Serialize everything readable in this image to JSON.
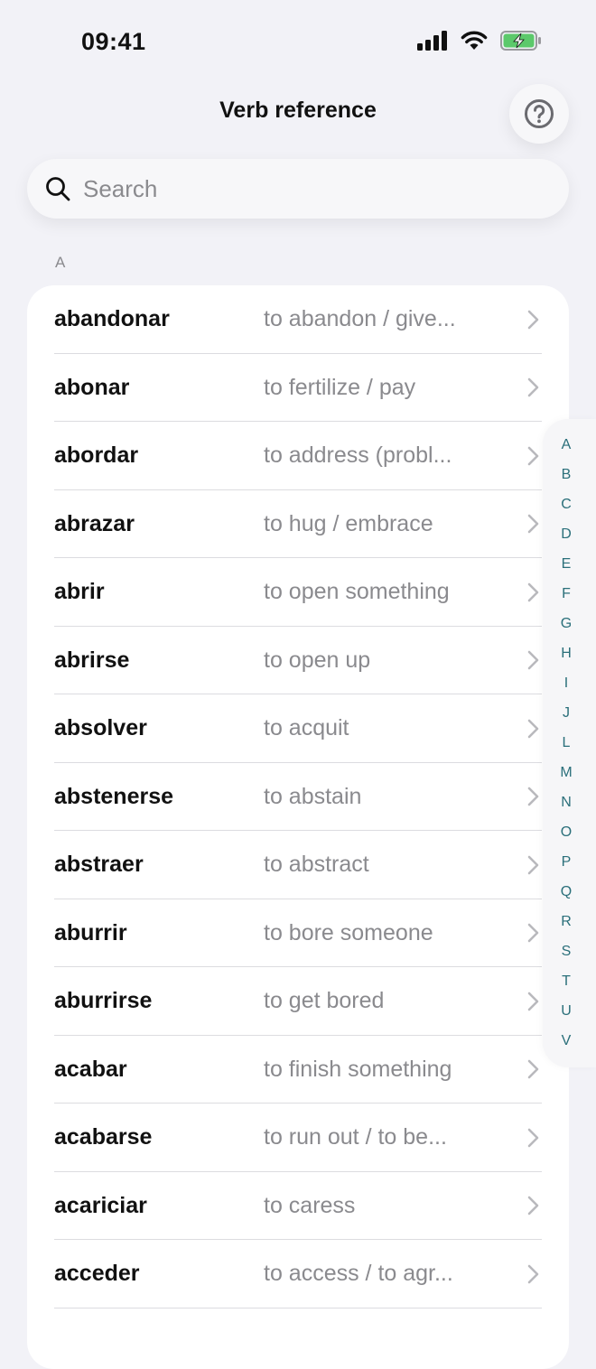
{
  "status_bar": {
    "time": "09:41"
  },
  "nav": {
    "title": "Verb reference",
    "help_icon": "question-circle-icon"
  },
  "search": {
    "placeholder": "Search",
    "value": ""
  },
  "section": {
    "letter": "A"
  },
  "verbs": [
    {
      "term": "abandonar",
      "definition": "to abandon / give..."
    },
    {
      "term": "abonar",
      "definition": "to fertilize / pay"
    },
    {
      "term": "abordar",
      "definition": "to address (probl..."
    },
    {
      "term": "abrazar",
      "definition": "to hug / embrace"
    },
    {
      "term": "abrir",
      "definition": "to open something"
    },
    {
      "term": "abrirse",
      "definition": "to open up"
    },
    {
      "term": "absolver",
      "definition": "to acquit"
    },
    {
      "term": "abstenerse",
      "definition": "to abstain"
    },
    {
      "term": "abstraer",
      "definition": "to abstract"
    },
    {
      "term": "aburrir",
      "definition": "to bore someone"
    },
    {
      "term": "aburrirse",
      "definition": "to get bored"
    },
    {
      "term": "acabar",
      "definition": "to finish something"
    },
    {
      "term": "acabarse",
      "definition": "to run out / to be..."
    },
    {
      "term": "acariciar",
      "definition": "to caress"
    },
    {
      "term": "acceder",
      "definition": "to access / to agr..."
    }
  ],
  "index_letters": [
    "A",
    "B",
    "C",
    "D",
    "E",
    "F",
    "G",
    "H",
    "I",
    "J",
    "L",
    "M",
    "N",
    "O",
    "P",
    "Q",
    "R",
    "S",
    "T",
    "U",
    "V"
  ],
  "colors": {
    "background": "#f2f2f7",
    "card": "#ffffff",
    "index_accent": "#2a6f7a",
    "battery_green": "#5cc96b"
  }
}
